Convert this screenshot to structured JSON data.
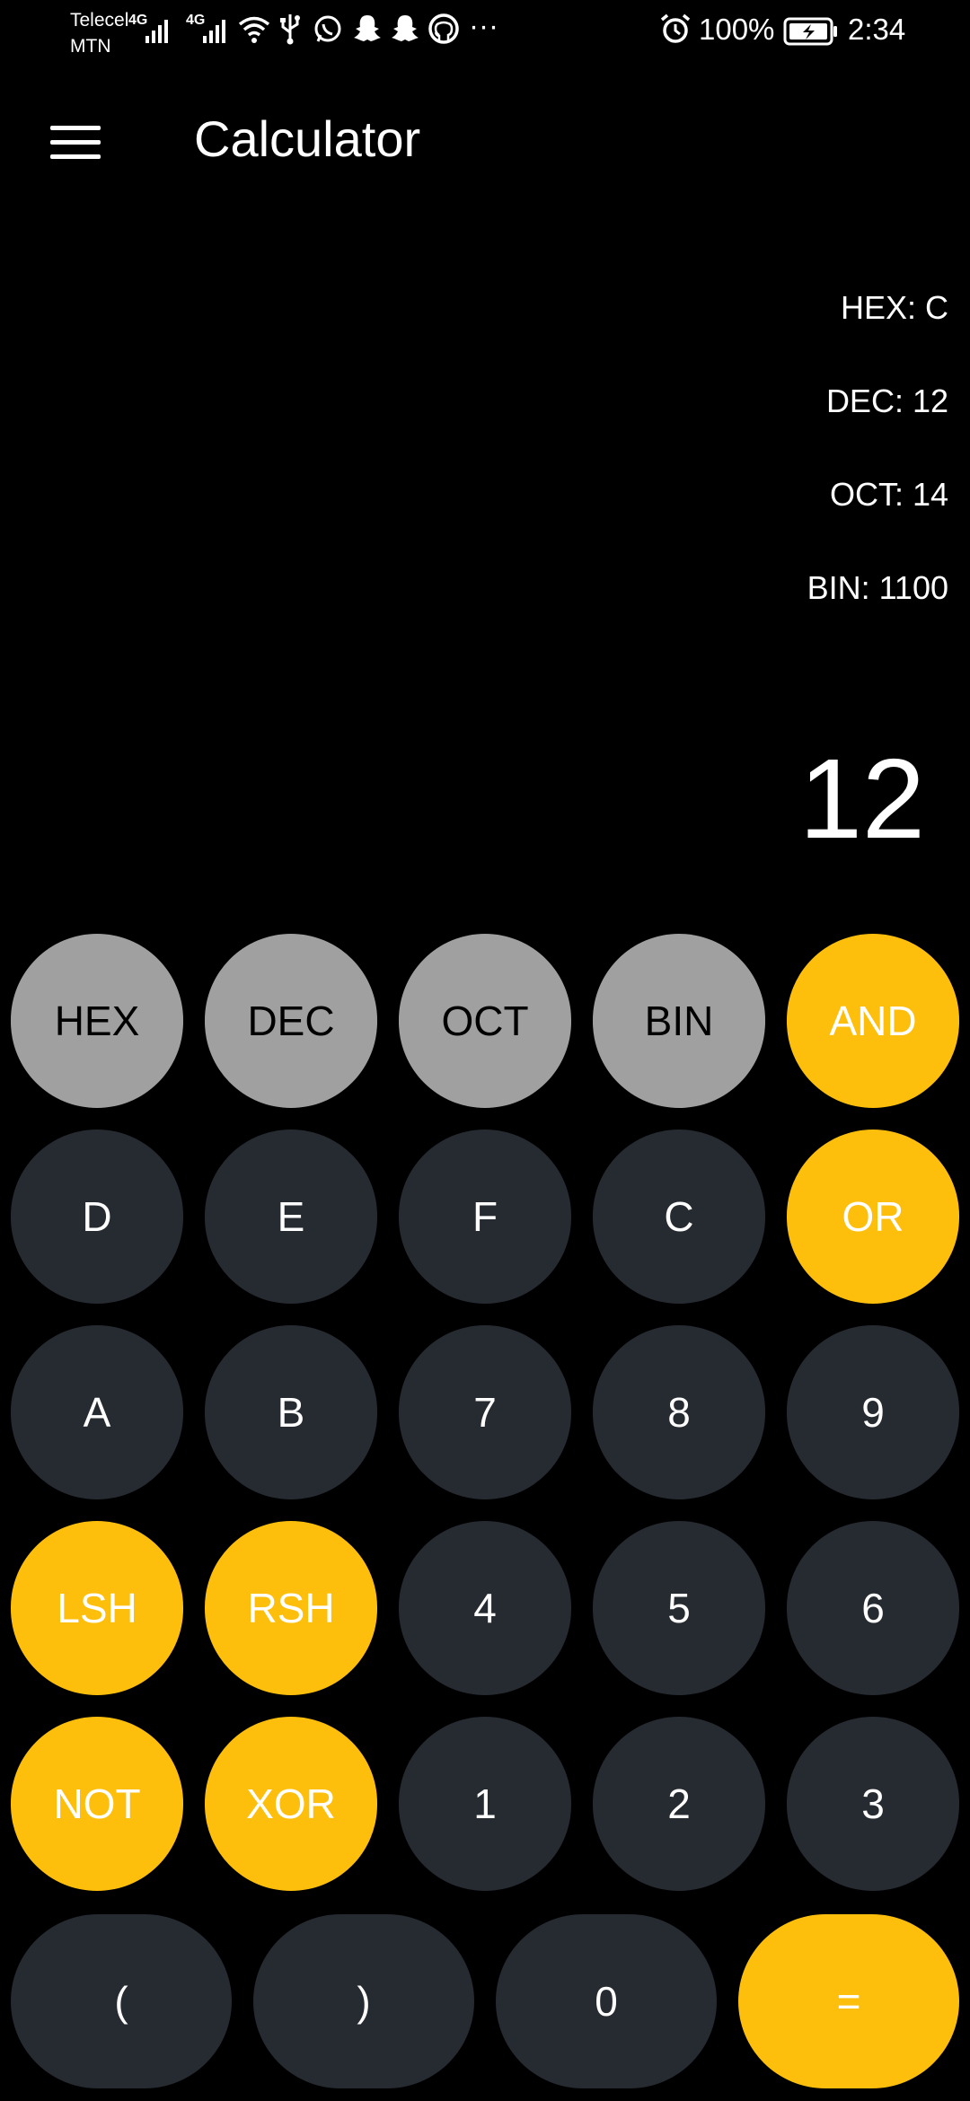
{
  "status_bar": {
    "carrier_line1": "Telecel",
    "carrier_line2": "MTN",
    "network1": "4G",
    "network2": "4G",
    "more": "···",
    "battery_percent": "100%",
    "time": "2:34"
  },
  "app_bar": {
    "title": "Calculator"
  },
  "readouts": {
    "hex": "HEX: C",
    "dec": "DEC: 12",
    "oct": "OCT: 14",
    "bin": "BIN: 1100"
  },
  "display": {
    "value": "12"
  },
  "keypad": {
    "row1": [
      "HEX",
      "DEC",
      "OCT",
      "BIN",
      "AND"
    ],
    "row2": [
      "D",
      "E",
      "F",
      "C",
      "OR"
    ],
    "row3": [
      "A",
      "B",
      "7",
      "8",
      "9"
    ],
    "row4": [
      "LSH",
      "RSH",
      "4",
      "5",
      "6"
    ],
    "row5": [
      "NOT",
      "XOR",
      "1",
      "2",
      "3"
    ],
    "row6": [
      "(",
      ")",
      "0",
      "="
    ]
  },
  "colors": {
    "background": "#000000",
    "key_dark": "#262a31",
    "key_gray": "#a0a0a0",
    "key_accent": "#fdbf0b"
  }
}
